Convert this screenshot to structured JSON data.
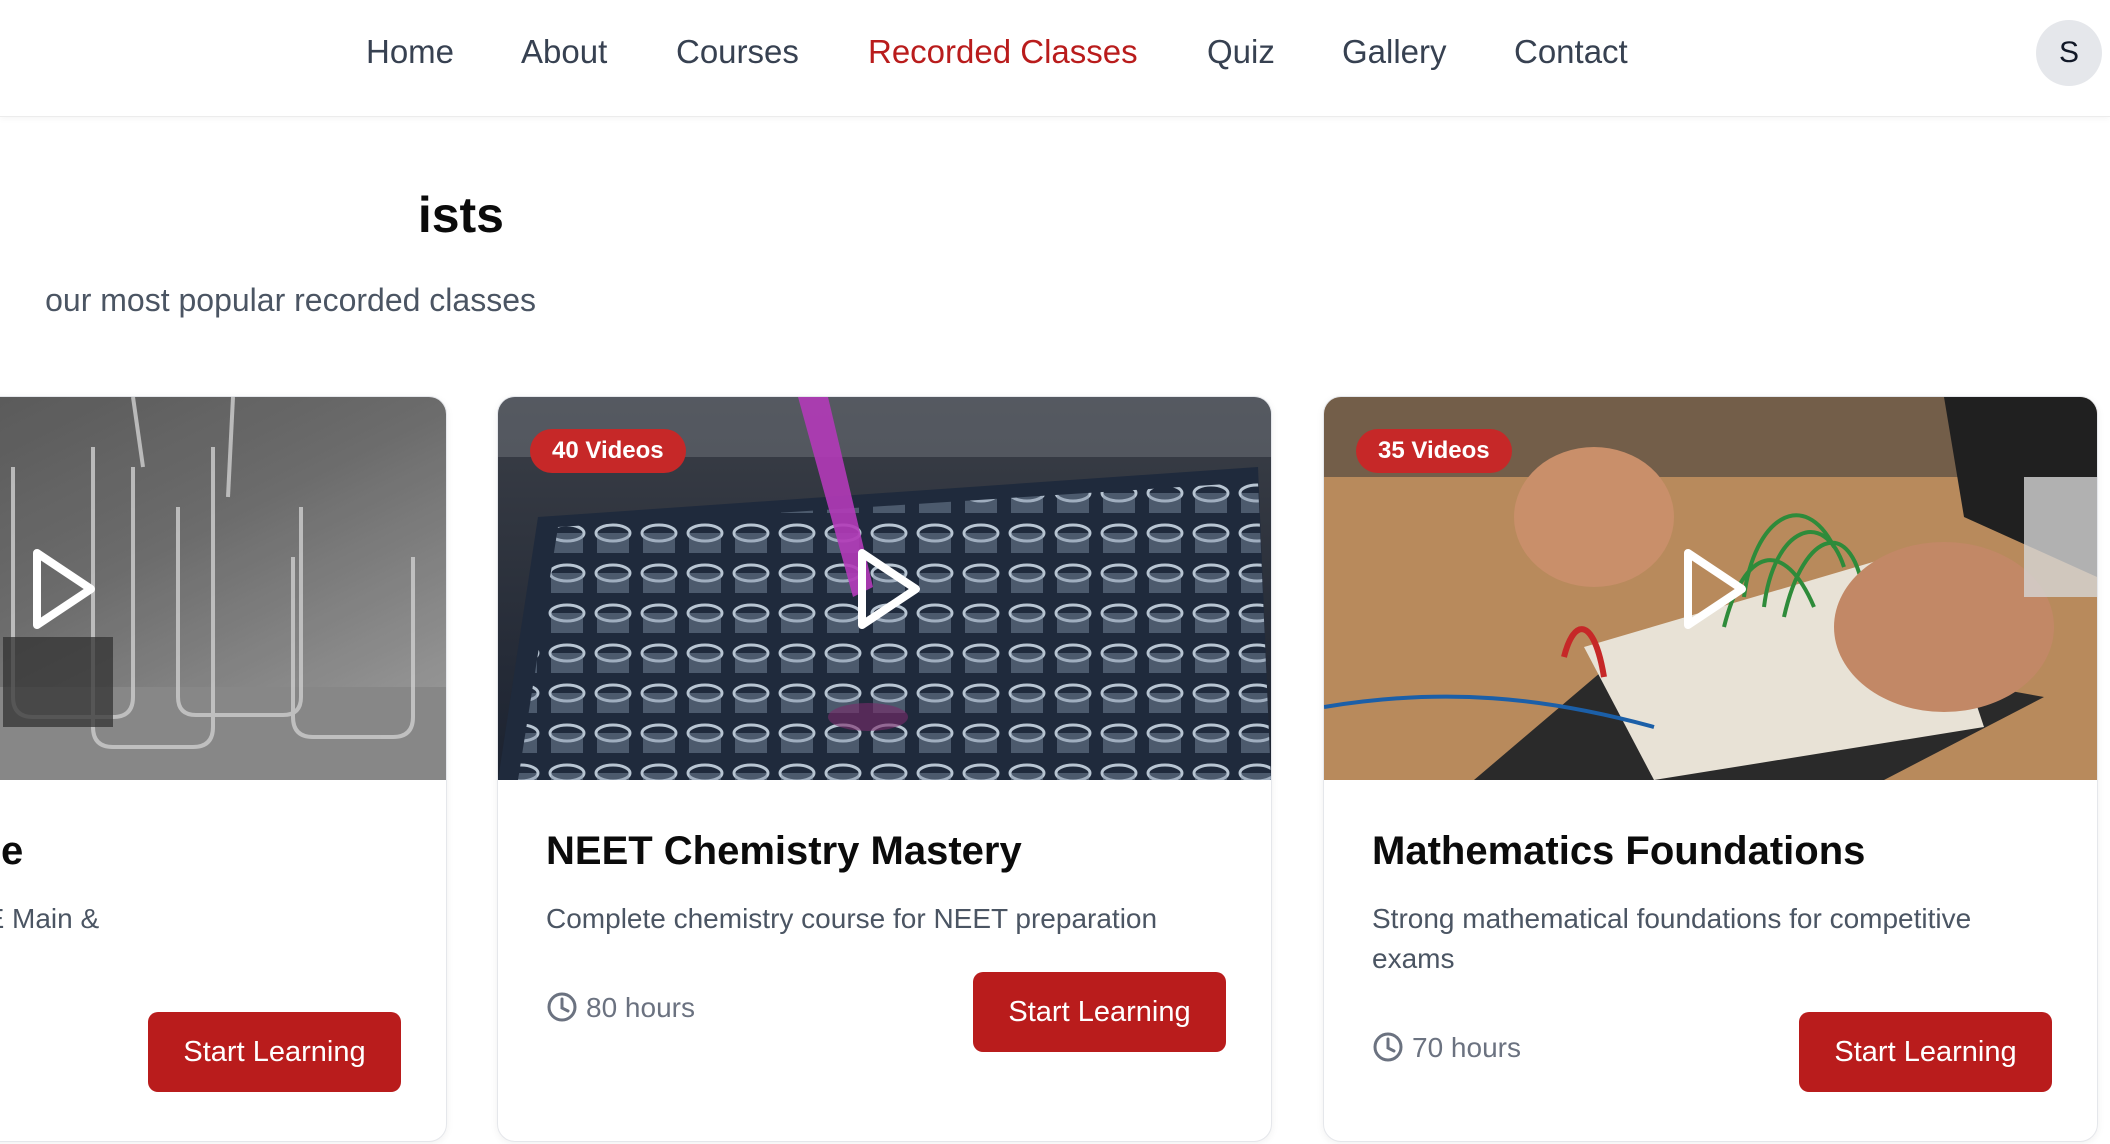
{
  "nav": {
    "items": [
      "Home",
      "About",
      "Courses",
      "Recorded Classes",
      "Quiz",
      "Gallery",
      "Contact"
    ],
    "active": "Recorded Classes",
    "avatar_initial": "S"
  },
  "section": {
    "title": "ists",
    "subtitle": "our most popular recorded classes"
  },
  "cards": [
    {
      "title": "omplete Course",
      "description": "ics preparation for JEE Main &",
      "button": "Start Learning",
      "image": "glass-beakers-lab-photo"
    },
    {
      "badge": "40 Videos",
      "title": "NEET Chemistry Mastery",
      "description": "Complete chemistry course for NEET preparation",
      "duration": "80 hours",
      "button": "Start Learning",
      "image": "test-tubes-tray-photo"
    },
    {
      "badge": "35 Videos",
      "title": "Mathematics Foundations",
      "description": "Strong mathematical foundations for competitive exams",
      "duration": "70 hours",
      "button": "Start Learning",
      "image": "breadboard-wiring-photo"
    }
  ],
  "colors": {
    "accent": "#b91c1c",
    "badge": "#c62828",
    "nav_text": "#374151",
    "body_text": "#4b5563"
  },
  "icons": [
    "play-icon",
    "clock-icon"
  ]
}
